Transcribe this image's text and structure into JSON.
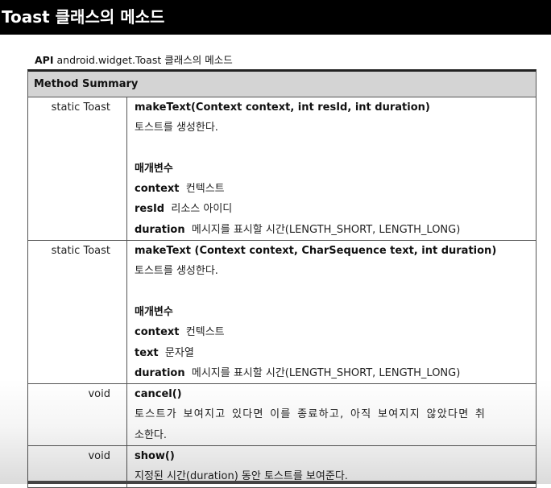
{
  "title": "Toast 클래스의 메소드",
  "caption": {
    "bold": "API",
    "rest": "android.widget.Toast 클래스의  메소드"
  },
  "summary_header": "Method Summary",
  "rows": [
    {
      "type": "static Toast",
      "signature": "makeText(Context context, int resId, int duration)",
      "description": "토스트를 생성한다.",
      "params_heading": "매개변수",
      "params": [
        {
          "name": "context",
          "desc": "컨텍스트"
        },
        {
          "name": "resId",
          "desc": "리소스 아이디"
        },
        {
          "name": "duration",
          "desc": "메시지를 표시할 시간(LENGTH_SHORT, LENGTH_LONG)"
        }
      ]
    },
    {
      "type": "static Toast",
      "signature": "makeText (Context context, CharSequence text, int duration)",
      "description": "토스트를 생성한다.",
      "params_heading": "매개변수",
      "params": [
        {
          "name": "context",
          "desc": "컨텍스트"
        },
        {
          "name": "text",
          "desc": "문자열"
        },
        {
          "name": "duration",
          "desc": "메시지를 표시할 시간(LENGTH_SHORT, LENGTH_LONG)"
        }
      ]
    },
    {
      "type": "void",
      "signature": "cancel()",
      "description_lines": [
        "토스트가 보여지고 있다면 이를 종료하고, 아직 보여지지 않았다면 취",
        "소한다."
      ]
    },
    {
      "type": "void",
      "signature": "show()",
      "description": "지정된 시간(duration) 동안 토스트를 보여준다."
    }
  ]
}
